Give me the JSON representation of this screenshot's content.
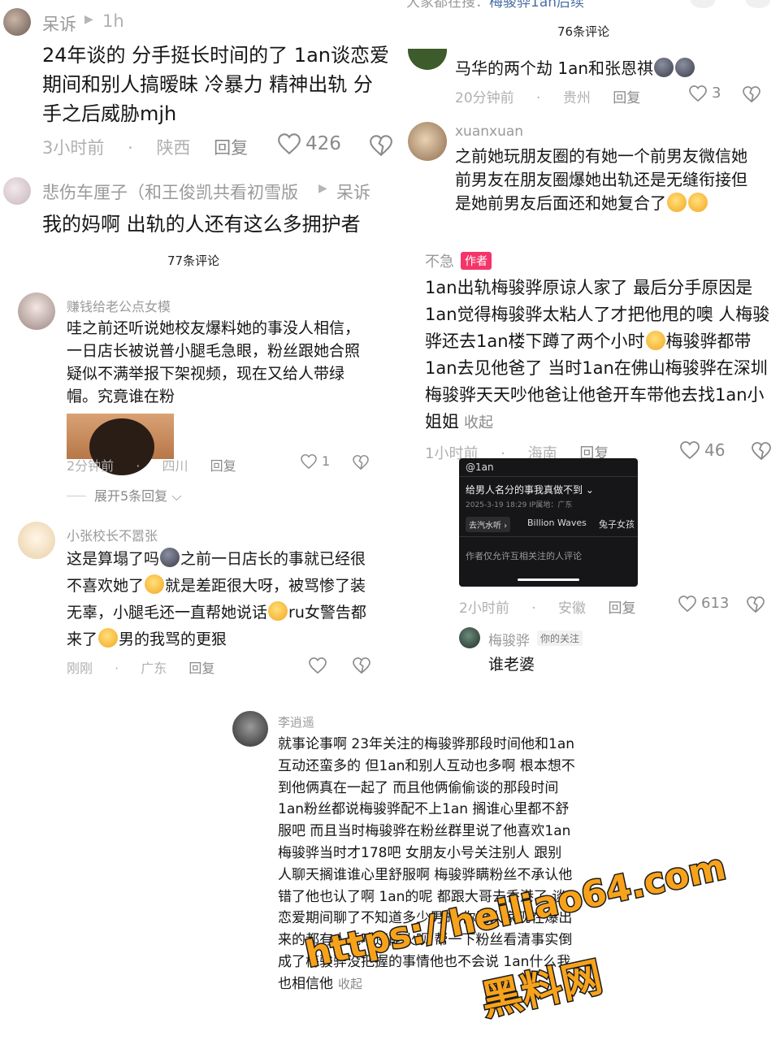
{
  "panel1": {
    "username": "呆诉",
    "time_short": "1h",
    "body": "24年谈的 分手挺长时间的了 1an谈恋爱期间和别人搞暧昧 冷暴力 精神出轨 分手之后威胁mjh",
    "time": "3小时前",
    "location": "陕西",
    "reply": "回复",
    "likes": "426",
    "reply2_user": "悲伤车厘子（和王俊凯共看初雪版",
    "reply2_target": "呆诉",
    "reply2_body": "我的妈啊 出轨的人还有这么多拥护者"
  },
  "panel2": {
    "header_hint": "大家都在搜：",
    "header_link": "梅骏骅1an后续",
    "count": "76条评论",
    "c1_body": "马华的两个劫 1an和张恩祺",
    "c1_time": "20分钟前",
    "c1_location": "贵州",
    "c1_reply": "回复",
    "c1_likes": "3",
    "c2_user": "xuanxuan",
    "c2_body": "之前她玩朋友圈的有她一个前男友微信她前男友在朋友圈爆她出轨还是无缝衔接但是她前男友后面还和她复合了"
  },
  "panel3": {
    "count": "77条评论",
    "c1_user": "赚钱给老公点女模",
    "c1_body": "哇之前还听说她校友爆料她的事没人相信，一日店长被说普小腿毛急眼，粉丝跟她合照疑似不满举报下架视频，现在又给人带绿帽。究竟谁在粉",
    "c1_time": "2分钟前",
    "c1_location": "四川",
    "c1_reply": "回复",
    "c1_likes": "1",
    "expand": "展开5条回复",
    "c2_user": "小张校长不嚣张",
    "c2_body_a": "这是算塌了吗",
    "c2_body_b": "之前一日店长的事就已经很不喜欢她了",
    "c2_body_c": "就是差距很大呀，被骂惨了装无辜，小腿毛还一直帮她说话",
    "c2_body_d": "ru女警告都来了",
    "c2_body_e": "男的我骂的更狠",
    "c2_time": "刚刚",
    "c2_location": "广东",
    "c2_reply": "回复"
  },
  "panel4": {
    "user": "不急",
    "author_tag": "作者",
    "body_a": "1an出轨梅骏骅原谅人家了 最后分手原因是1an觉得梅骏骅太粘人了才把他甩的噢 人梅骏骅还去1an楼下蹲了两个小时",
    "body_b": "梅骏骅都带1an去见他爸了 当时1an在佛山梅骏骅在深圳 梅骏骅天天吵他爸让他爸开车带他去找1an小姐姐",
    "collapse": "收起",
    "time": "1小时前",
    "location": "海南",
    "reply": "回复",
    "likes": "46",
    "shot_handle": "@1an",
    "shot_title": "给男人名分的事我真做不到",
    "shot_meta": "2025-3-19 18:29  IP属地：广东",
    "shot_tag": "去汽水听",
    "shot_song": "Billion Waves",
    "shot_song2": "兔子女孩",
    "shot_notice": "作者仅允许互相关注的人评论",
    "c2_time": "2小时前",
    "c2_location": "安徽",
    "c2_reply": "回复",
    "c2_likes": "613",
    "reply_user": "梅骏骅",
    "reply_tag": "你的关注",
    "reply_body": "谁老婆"
  },
  "panel5": {
    "user": "李逍遥",
    "body": "就事论事啊 23年关注的梅骏骅那段时间他和1an互动还蛮多的 但1an和别人互动也多啊 根本想不到他俩真在一起了 而且他俩偷偷谈的那段时间1an粉丝都说梅骏骅配不上1an 搁谁心里都不舒服吧 而且当时梅骏骅在粉丝群里说了他喜欢1an 梅骏骅当时才178吧 女朋友小号关注别人 跟别人聊天搁谁谁心里舒服啊 梅骏骅瞒粉丝不承认他错了他也认了啊 1an的呢 都跟大哥去香港了 谈恋爱期间聊了不知道多少男的 你说人家现在爆出来的都有人凭啥还能火呗 帮一下粉丝看清事实倒成了梅骏骅没把握的事情他也不会说 1an什么我也相信他",
    "collapse": "收起"
  },
  "watermark": {
    "url": "https://heiliao64.com",
    "name": "黑料网"
  }
}
